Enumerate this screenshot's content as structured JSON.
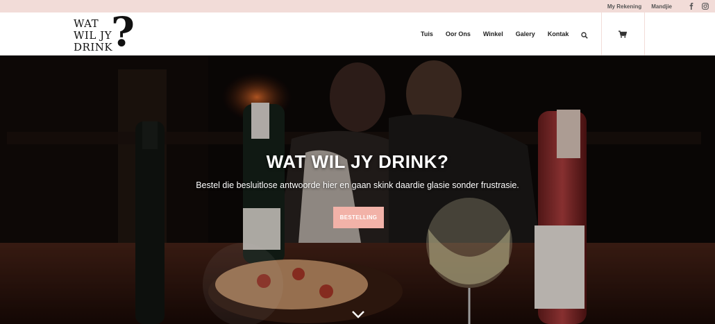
{
  "topbar": {
    "account_label": "My Rekening",
    "cart_label": "Mandjie",
    "icons": [
      "facebook-icon",
      "instagram-icon"
    ]
  },
  "logo": {
    "line1": "WAT",
    "line2": "WIL JY",
    "line3": "DRINK",
    "mark": "?"
  },
  "nav": {
    "items": [
      "Tuis",
      "Oor Ons",
      "Winkel",
      "Galery",
      "Kontak"
    ],
    "icons": [
      "search-icon",
      "cart-icon"
    ]
  },
  "hero": {
    "title": "WAT WIL JY DRINK?",
    "subtitle": "Bestel die besluitlose antwoorde hier en gaan skink daardie glasie sonder frustrasie.",
    "button_label": "BESTELLING",
    "scroll_icon": "chevron-down-icon"
  },
  "colors": {
    "topbar_bg": "#f2dcd8",
    "accent": "#f2b2a8",
    "header_bg": "#ffffff",
    "text_dark": "#222222"
  }
}
